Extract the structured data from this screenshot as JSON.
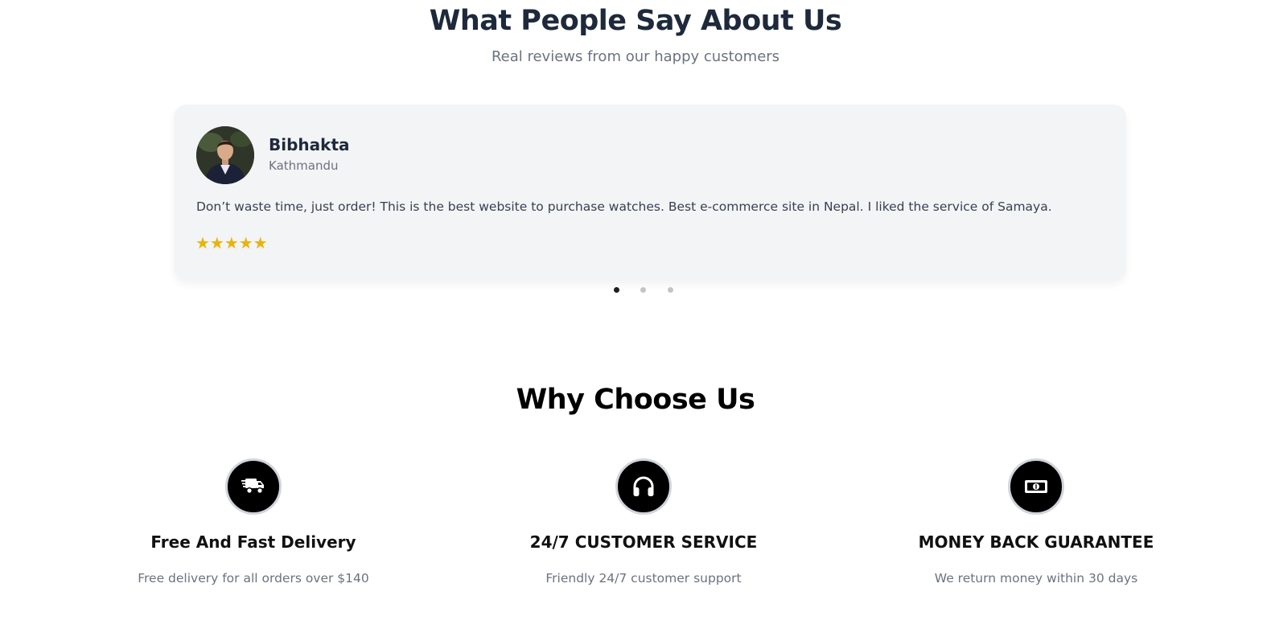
{
  "testimonials": {
    "title": "What People Say About Us",
    "subtitle": "Real reviews from our happy customers",
    "review": {
      "name": "Bibhakta",
      "location": "Kathmandu",
      "text": "Don’t waste time, just order! This is the best website to purchase watches. Best e-commerce site in Nepal. I liked the service of Samaya.",
      "stars": "★★★★★",
      "rating": 5
    },
    "carousel": {
      "slides": 3,
      "active_index": 0
    }
  },
  "why_choose": {
    "title": "Why Choose Us",
    "features": [
      {
        "icon": "delivery-truck-icon",
        "title": "Free And Fast Delivery",
        "description": "Free delivery for all orders over $140"
      },
      {
        "icon": "headphones-icon",
        "title": "24/7 CUSTOMER SERVICE",
        "description": "Friendly 24/7 customer support"
      },
      {
        "icon": "money-icon",
        "title": "MONEY BACK GUARANTEE",
        "description": "We return money within 30 days"
      }
    ]
  },
  "colors": {
    "star": "#eab308",
    "card_background": "#f3f4f6",
    "icon_background": "#000000",
    "dot_active": "#1f1f1f",
    "dot_inactive": "#c4c4c4"
  }
}
